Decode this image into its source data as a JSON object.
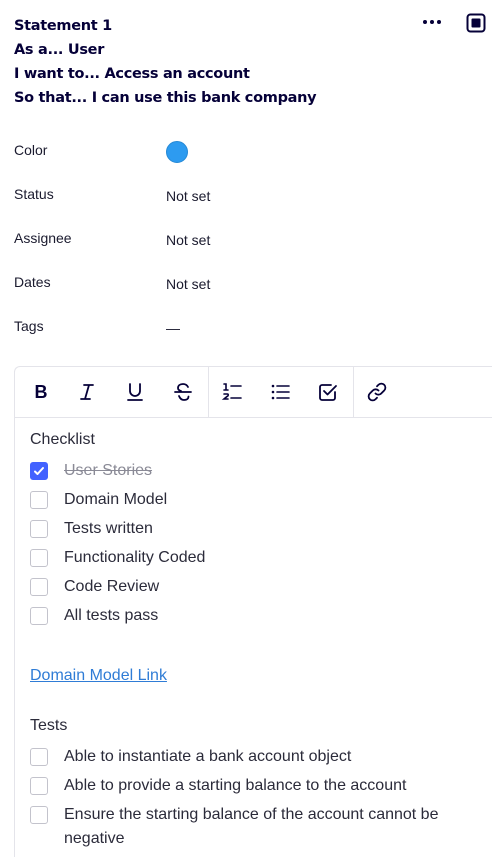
{
  "header": {
    "title": "Statement 1",
    "as_a": "As a... User",
    "i_want": "I want to... Access an account",
    "so_that": "So that... I can use this bank company"
  },
  "icons": {
    "more": "more-horizontal-icon",
    "collapse": "collapse-panel-icon"
  },
  "properties": [
    {
      "label": "Color",
      "value": "",
      "color": "#2d9bf0"
    },
    {
      "label": "Status",
      "value": "Not set"
    },
    {
      "label": "Assignee",
      "value": "Not set"
    },
    {
      "label": "Dates",
      "value": "Not set"
    },
    {
      "label": "Tags",
      "value": "—"
    }
  ],
  "toolbar": [
    "bold-icon",
    "italic-icon",
    "underline-icon",
    "strikethrough-icon",
    "numbered-list-icon",
    "bulleted-list-icon",
    "checklist-icon",
    "link-icon"
  ],
  "checklist": {
    "title": "Checklist",
    "items": [
      {
        "label": "User Stories",
        "checked": true
      },
      {
        "label": "Domain Model",
        "checked": false
      },
      {
        "label": "Tests written",
        "checked": false
      },
      {
        "label": "Functionality Coded",
        "checked": false
      },
      {
        "label": "Code Review",
        "checked": false
      },
      {
        "label": "All tests pass",
        "checked": false
      }
    ]
  },
  "link_text": "Domain Model Link",
  "tests": {
    "title": "Tests",
    "items": [
      {
        "label": "Able to instantiate a bank account object",
        "checked": false
      },
      {
        "label": "Able to provide a starting balance to the account",
        "checked": false
      },
      {
        "label": "Ensure the starting balance of the account cannot be negative",
        "checked": false
      }
    ]
  },
  "colors": {
    "text": "#050038",
    "accent": "#4262ff",
    "link": "#2f7cd6",
    "swatch": "#2d9bf0"
  }
}
